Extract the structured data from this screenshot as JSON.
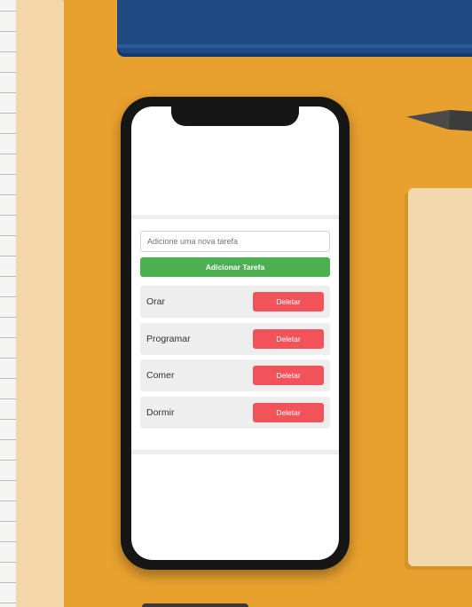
{
  "input": {
    "placeholder": "Adicione uma nova tarefa"
  },
  "add_button": {
    "label": "Adicionar Tarefa"
  },
  "tasks": [
    {
      "label": "Orar",
      "delete_label": "Deletar"
    },
    {
      "label": "Programar",
      "delete_label": "Deletar"
    },
    {
      "label": "Comer",
      "delete_label": "Deletar"
    },
    {
      "label": "Dormir",
      "delete_label": "Deletar"
    }
  ],
  "colors": {
    "background": "#e8a12e",
    "add_button": "#4caf50",
    "delete_button": "#f2535a",
    "item_background": "#eeeeee"
  }
}
